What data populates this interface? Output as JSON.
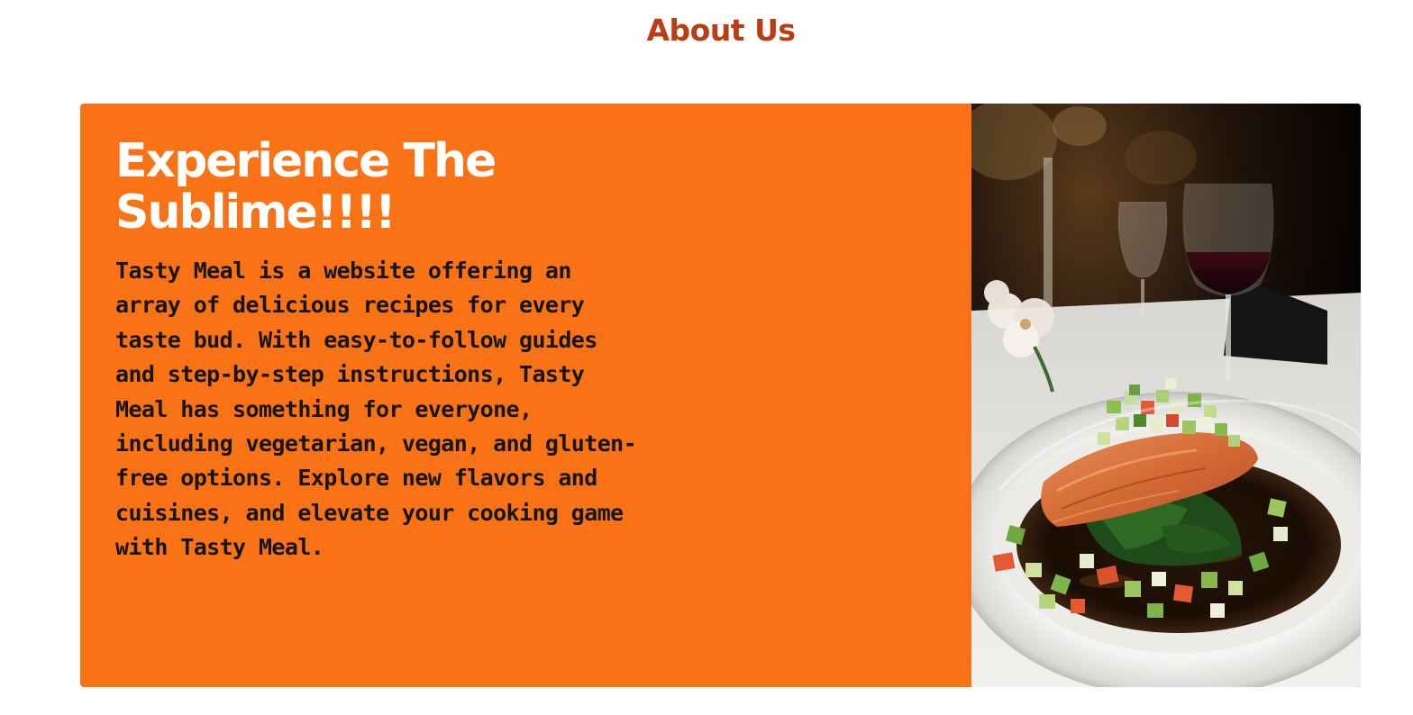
{
  "section": {
    "title": "About Us"
  },
  "about_card": {
    "headline": "Experience The Sublime!!!!",
    "description": "Tasty Meal is a website offering an array of delicious recipes for every taste bud. With easy-to-follow guides and step-by-step instructions, Tasty Meal has something for everyone, including vegetarian, vegan, and gluten-free options. Explore new flavors and cuisines, and elevate your cooking game with Tasty Meal."
  },
  "colors": {
    "title": "#b93e14",
    "card_background": "#f97316",
    "headline": "#ffffff",
    "body_text": "#161616"
  },
  "image": {
    "subject": "plated-salmon-dish-icon"
  }
}
